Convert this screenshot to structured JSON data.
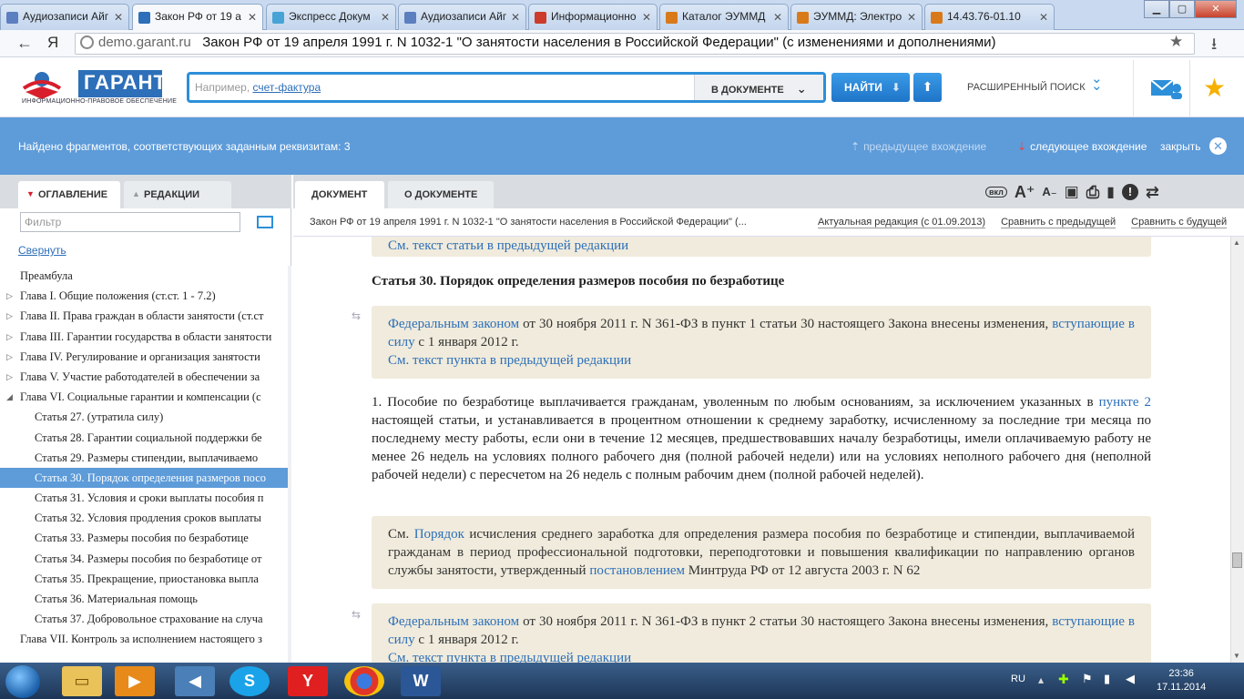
{
  "browser": {
    "tabs": [
      {
        "label": "Аудиозаписи Айг",
        "active": false
      },
      {
        "label": "Закон РФ от 19 а",
        "active": true
      },
      {
        "label": "Экспресс Докум",
        "active": false
      },
      {
        "label": "Аудиозаписи Айг",
        "active": false
      },
      {
        "label": "Информационно",
        "active": false
      },
      {
        "label": "Каталог ЭУММД",
        "active": false
      },
      {
        "label": "ЭУММД: Электро",
        "active": false
      },
      {
        "label": "14.43.76-01.10",
        "active": false
      }
    ],
    "url_host": "demo.garant.ru",
    "url_title": "Закон РФ от 19 апреля 1991 г. N 1032-1 \"О занятости населения в Российской Федерации\" (с изменениями и дополнениями)",
    "back_glyph": "←",
    "ya_glyph": "Я",
    "star_glyph": "★",
    "download_glyph": "⭳"
  },
  "garant": {
    "logo_text": "ГАРАНТ",
    "logo_sub": "ИНФОРМАЦИОННО-ПРАВОВОЕ ОБЕСПЕЧЕНИЕ",
    "search_placeholder_prefix": "Например, ",
    "search_placeholder_link": "счет-фактура",
    "scope": "В ДОКУМЕНТЕ",
    "find_label": "НАЙТИ",
    "advanced_search": "РАСШИРЕННЫЙ ПОИСК"
  },
  "found": {
    "text": "Найдено фрагментов, соответствующих заданным реквизитам: 3",
    "prev": "предыдущее вхождение",
    "next": "следующее вхождение",
    "close": "закрыть"
  },
  "left": {
    "tab_toc": "ОГЛАВЛЕНИЕ",
    "tab_editions": "РЕДАКЦИИ",
    "filter_placeholder": "Фильтр",
    "collapse": "Свернуть",
    "toc": [
      {
        "label": "Преамбула",
        "indent": 0,
        "arrow": "",
        "selected": false
      },
      {
        "label": "Глава I. Общие положения (ст.ст. 1 - 7.2)",
        "indent": 0,
        "arrow": "▷",
        "selected": false
      },
      {
        "label": "Глава II. Права граждан в области занятости (ст.ст",
        "indent": 0,
        "arrow": "▷",
        "selected": false
      },
      {
        "label": "Глава III. Гарантии государства в области занятости",
        "indent": 0,
        "arrow": "▷",
        "selected": false
      },
      {
        "label": "Глава IV. Регулирование и организация занятости",
        "indent": 0,
        "arrow": "▷",
        "selected": false
      },
      {
        "label": "Глава V. Участие работодателей в обеспечении за",
        "indent": 0,
        "arrow": "▷",
        "selected": false
      },
      {
        "label": "Глава VI. Социальные гарантии и компенсации (с",
        "indent": 0,
        "arrow": "◢",
        "selected": false
      },
      {
        "label": "Статья 27. (утратила силу)",
        "indent": 1,
        "arrow": "",
        "selected": false
      },
      {
        "label": "Статья 28. Гарантии социальной поддержки бе",
        "indent": 1,
        "arrow": "",
        "selected": false
      },
      {
        "label": "Статья 29. Размеры стипендии, выплачиваемо",
        "indent": 1,
        "arrow": "",
        "selected": false
      },
      {
        "label": "Статья 30. Порядок определения размеров посо",
        "indent": 1,
        "arrow": "",
        "selected": true
      },
      {
        "label": "Статья 31. Условия и сроки выплаты пособия п",
        "indent": 1,
        "arrow": "",
        "selected": false
      },
      {
        "label": "Статья 32. Условия продления сроков выплаты",
        "indent": 1,
        "arrow": "",
        "selected": false
      },
      {
        "label": "Статья 33. Размеры пособия по безработице",
        "indent": 1,
        "arrow": "",
        "selected": false
      },
      {
        "label": "Статья 34. Размеры пособия по безработице от",
        "indent": 1,
        "arrow": "",
        "selected": false
      },
      {
        "label": "Статья 35. Прекращение, приостановка выпла",
        "indent": 1,
        "arrow": "",
        "selected": false
      },
      {
        "label": "Статья 36. Материальная помощь",
        "indent": 1,
        "arrow": "",
        "selected": false
      },
      {
        "label": "Статья 37. Добровольное страхование на случа",
        "indent": 1,
        "arrow": "",
        "selected": false
      },
      {
        "label": "Глава VII. Контроль за исполнением настоящего з",
        "indent": 0,
        "arrow": "",
        "selected": false
      }
    ]
  },
  "right": {
    "tab_document": "ДОКУМЕНТ",
    "tab_about": "О ДОКУМЕНТЕ",
    "tools": {
      "vkl": "вкл",
      "font_up": "A⁺",
      "font_down": "A₋",
      "save": "▣",
      "print": "⎙",
      "bookmark": "▮",
      "alert": "!",
      "compare": "⇄"
    },
    "doc_line": "Закон РФ от 19 апреля 1991 г. N 1032-1 \"О занятости населения в Российской Федерации\" (...",
    "edition_current": "Актуальная редакция (с 01.09.2013)",
    "compare_prev": "Сравнить с предыдущей",
    "compare_next": "Сравнить с будущей",
    "top_note": "См. текст статьи в предыдущей редакции",
    "article_title": "Статья 30. Порядок определения размеров пособия по безработице",
    "note1": {
      "link1": "Федеральным законом",
      "text1": " от 30 ноября 2011 г. N 361-ФЗ в пункт 1 статьи 30 настоящего Закона внесены изменения, ",
      "link2": "вступающие в силу",
      "text2": " с 1 января 2012 г.",
      "link3": "См. текст пункта в предыдущей редакции"
    },
    "p1": {
      "text1": "1. Пособие по безработице выплачивается гражданам, уволенным по любым основаниям, за исключением указанных в ",
      "link": "пункте 2",
      "text2": " настоящей статьи, и устанавливается в процентном отношении к среднему заработку, исчисленному за последние три месяца по последнему месту работы, если они в течение 12 месяцев, предшествовавших началу безработицы, имели оплачиваемую работу не менее 26 недель на условиях полного рабочего дня (полной рабочей недели) или на условиях неполного рабочего дня (неполной рабочей недели) с пересчетом на 26 недель с полным рабочим днем (полной рабочей неделей)."
    },
    "note2": {
      "text1": "См. ",
      "link1": "Порядок",
      "text2": " исчисления среднего заработка для определения размера пособия по безработице и стипендии, выплачиваемой гражданам в период профессиональной подготовки, переподготовки и повышения квалификации по направлению органов службы занятости, утвержденный ",
      "link2": "постановлением",
      "text3": " Минтруда РФ от 12 августа 2003 г. N 62"
    },
    "note3": {
      "link1": "Федеральным законом",
      "text1": " от 30 ноября 2011 г. N 361-ФЗ в пункт 2 статьи 30 настоящего Закона внесены изменения, ",
      "link2": "вступающие в силу",
      "text2": " с 1 января 2012 г.",
      "link3": "См. текст пункта в предыдущей редакции"
    }
  },
  "taskbar": {
    "lang": "RU",
    "time": "23:36",
    "date": "17.11.2014",
    "apps": [
      "explorer",
      "media-player",
      "volume",
      "skype",
      "yandex-browser",
      "chrome",
      "word"
    ]
  }
}
